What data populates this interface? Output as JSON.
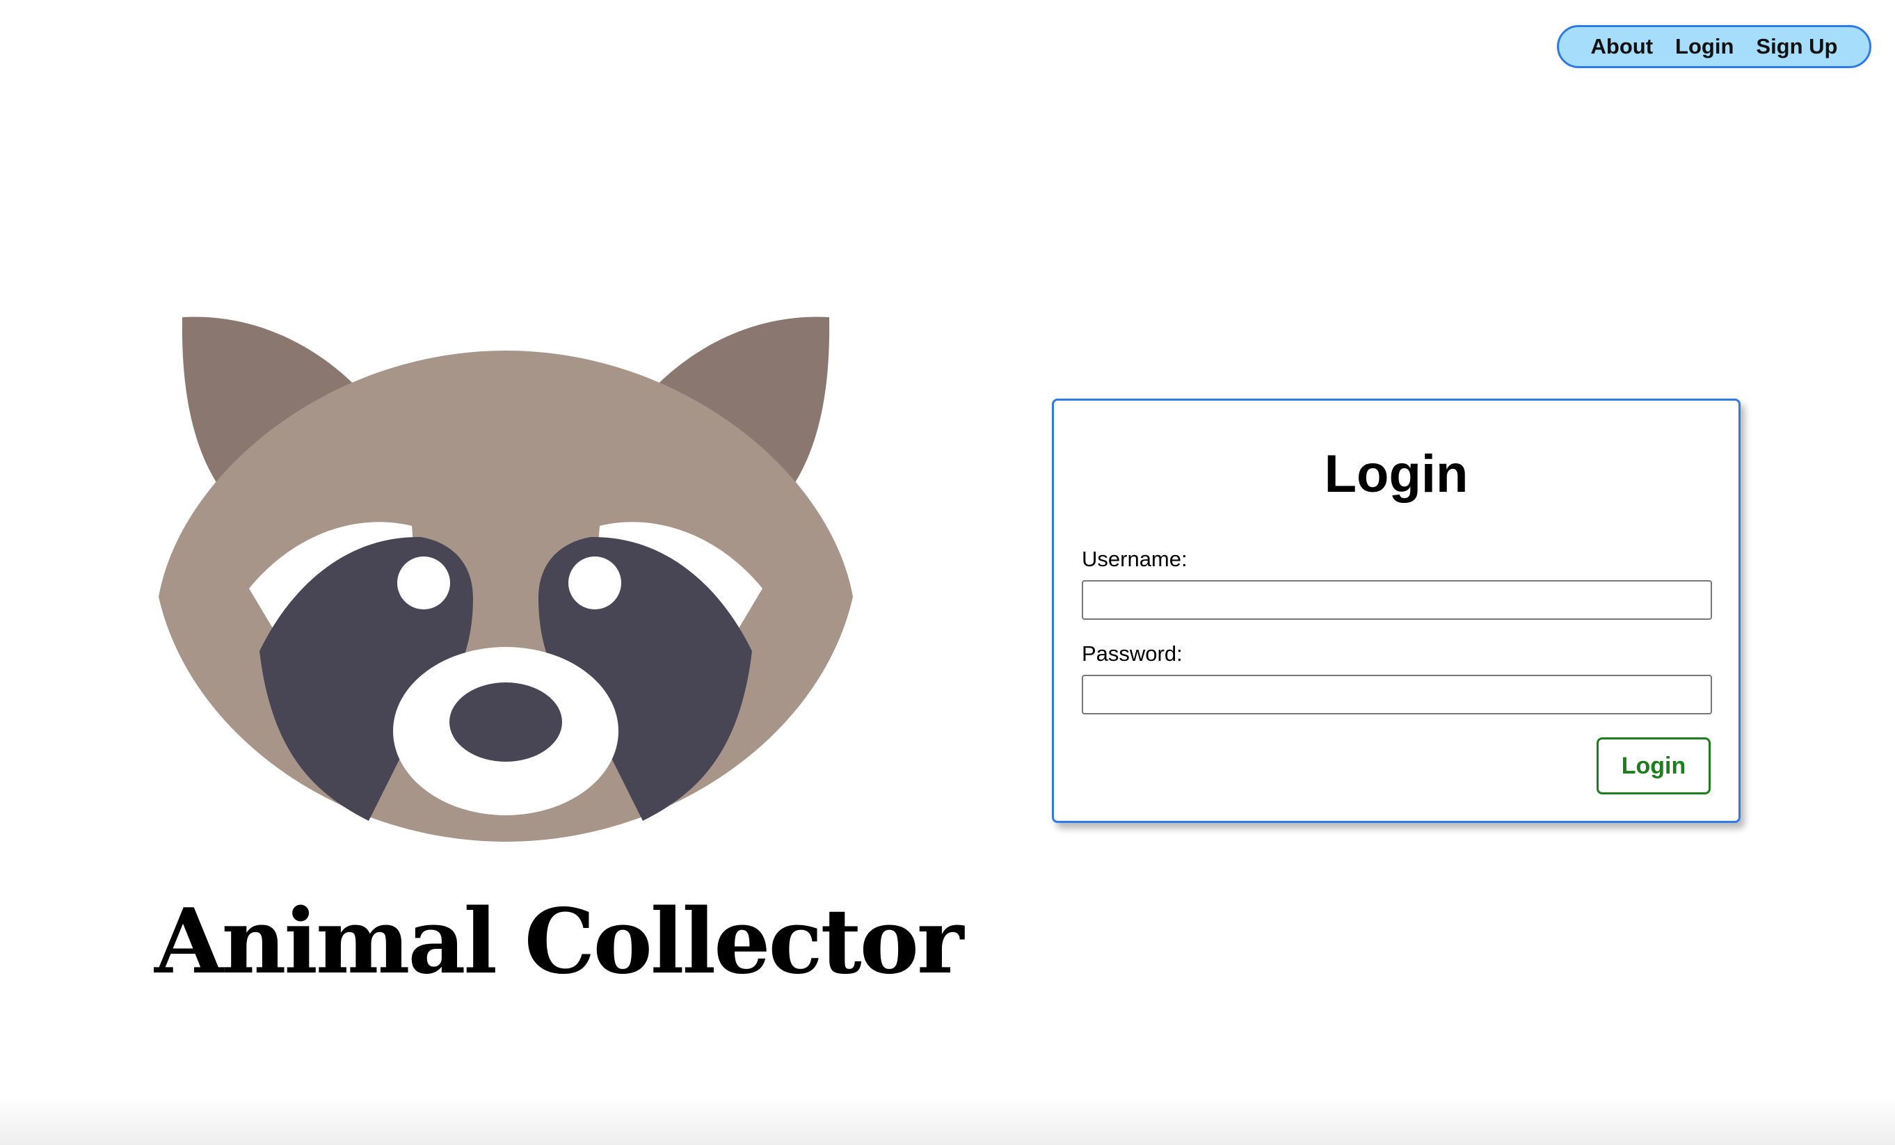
{
  "nav": {
    "items": [
      {
        "label": "About"
      },
      {
        "label": "Login"
      },
      {
        "label": "Sign Up"
      }
    ]
  },
  "brand": {
    "title": "Animal Collector",
    "logo_icon": "raccoon-face-icon"
  },
  "login_form": {
    "title": "Login",
    "username_label": "Username:",
    "username_value": "",
    "password_label": "Password:",
    "password_value": "",
    "submit_label": "Login"
  },
  "colors": {
    "nav_background": "#a6ddfa",
    "accent_border": "#2f7ae5",
    "submit_green": "#1e7d1e",
    "raccoon_fur": "#a8958a",
    "raccoon_ear": "#8a7770",
    "raccoon_mask": "#484654"
  }
}
